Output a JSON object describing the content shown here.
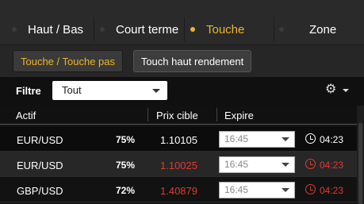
{
  "tabs": [
    {
      "label": "Haut / Bas",
      "active": false
    },
    {
      "label": "Court terme",
      "active": false
    },
    {
      "label": "Touche",
      "active": true
    },
    {
      "label": "Zone",
      "active": false
    }
  ],
  "subtabs": [
    {
      "label": "Touche / Touche pas",
      "active": true
    },
    {
      "label": "Touch haut rendement",
      "active": false
    }
  ],
  "filter": {
    "label": "Filtre",
    "selected": "Tout"
  },
  "table": {
    "headers": {
      "asset": "Actif",
      "target": "Prix cible",
      "expire": "Expire"
    },
    "rows": [
      {
        "asset": "EUR/USD",
        "payout": "75%",
        "target": "1.10105",
        "expire": "16:45",
        "time": "04:23",
        "urgent": false
      },
      {
        "asset": "EUR/USD",
        "payout": "75%",
        "target": "1.10025",
        "expire": "16:45",
        "time": "04:23",
        "urgent": true
      },
      {
        "asset": "GBP/USD",
        "payout": "72%",
        "target": "1.40879",
        "expire": "16:45",
        "time": "04:23",
        "urgent": true
      }
    ]
  },
  "colors": {
    "accent": "#f0b429",
    "alert": "#e03a2f"
  }
}
